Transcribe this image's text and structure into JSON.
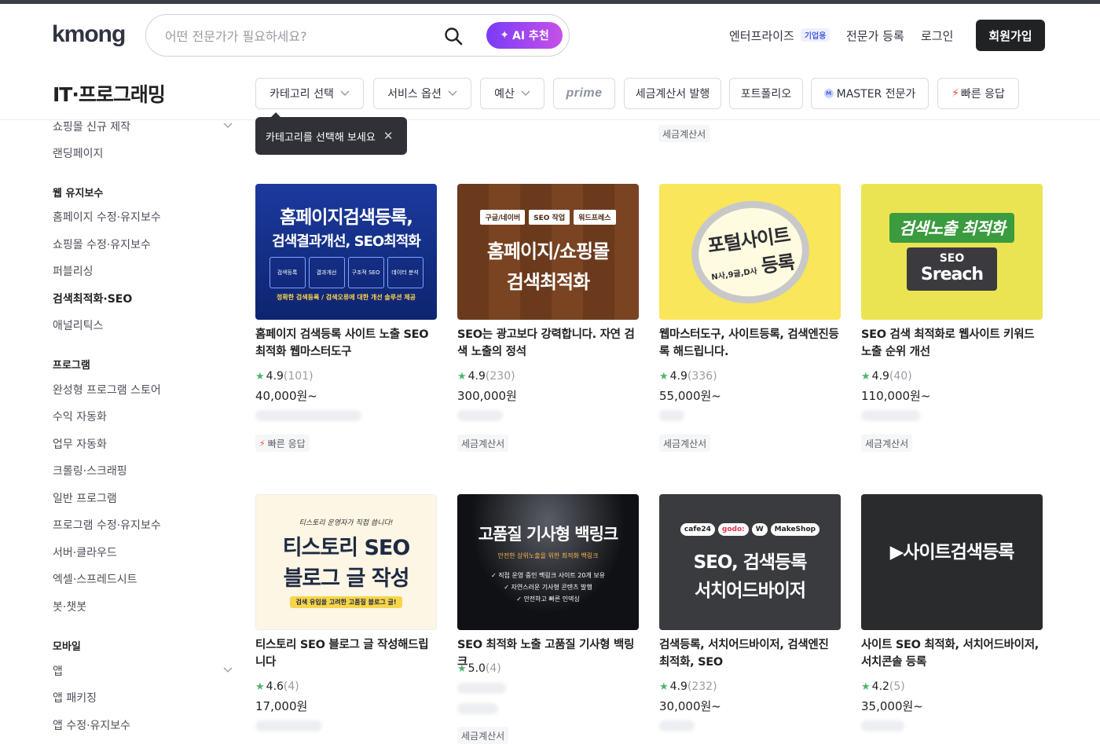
{
  "header": {
    "logo": "kmong",
    "search_placeholder": "어떤 전문가가 필요하세요?",
    "ai_label": "AI 추천",
    "nav": {
      "enterprise": "엔터프라이즈",
      "enterprise_badge": "기업용",
      "register_expert": "전문가 등록",
      "login": "로그인",
      "signup": "회원가입"
    }
  },
  "page_title": "IT·프로그래밍",
  "filters": {
    "category": "카테고리 선택",
    "service_option": "서비스 옵션",
    "budget": "예산",
    "prime": "prime",
    "tax_invoice": "세금계산서 발행",
    "portfolio": "포트폴리오",
    "master_badge": "M",
    "master": "MASTER 전문가",
    "fast_response": "빠른 응답"
  },
  "tooltip": {
    "text": "카테고리를 선택해 보세요"
  },
  "top_partial_tag": "세금계산서",
  "sidebar": {
    "items_top": [
      "쇼핑몰 신규 제작",
      "랜딩페이지"
    ],
    "web_maintenance_head": "웹 유지보수",
    "web_maintenance": [
      "홈페이지 수정·유지보수",
      "쇼핑몰 수정·유지보수",
      "퍼블리싱",
      "검색최적화·SEO",
      "애널리틱스"
    ],
    "program_head": "프로그램",
    "program": [
      "완성형 프로그램 스토어",
      "수익 자동화",
      "업무 자동화",
      "크롤링·스크래핑",
      "일반 프로그램",
      "프로그램 수정·유지보수",
      "서버·클라우드",
      "엑셀·스프레드시트",
      "봇·챗봇"
    ],
    "mobile_head": "모바일",
    "mobile": [
      "앱",
      "앱 패키징",
      "앱 수정·유지보수"
    ]
  },
  "cards": [
    {
      "thumb": {
        "title1": "홈페이지검색등록,",
        "title2": "검색결과개선, SEO최적화",
        "boxes": [
          "검색등록",
          "결과개선",
          "구조적 SEO",
          "데이터 분석"
        ],
        "footer": "정확한 검색등록 / 검색오류에 대한 개선 솔루션 제공"
      },
      "title": "홈페이지 검색등록 사이트 노출 SEO최적화 웹마스터도구",
      "rating": "4.9",
      "reviews": "(101)",
      "price": "40,000원~",
      "tag": "빠른 응답"
    },
    {
      "thumb": {
        "pills": [
          "구글/네이버",
          "SEO 작업",
          "워드프레스"
        ],
        "title1": "홈페이지/쇼핑몰",
        "title2": "검색최적화"
      },
      "title": "SEO는 광고보다 강력합니다. 자연 검색 노출의 정석",
      "rating": "4.9",
      "reviews": "(230)",
      "price": "300,000원",
      "tag": "세금계산서"
    },
    {
      "thumb": {
        "title1": "포털사이트",
        "title2": "등록",
        "sub": "N사,9글,D사"
      },
      "title": "웹마스터도구, 사이트등록, 검색엔진등록 해드립니다.",
      "rating": "4.9",
      "reviews": "(336)",
      "price": "55,000원~",
      "tag": "세금계산서"
    },
    {
      "thumb": {
        "title1": "검색노출 최적화",
        "title2": "SEO",
        "sub": "Sreach"
      },
      "title": "SEO 검색 최적화로 웹사이트 키워드 노출 순위 개선",
      "rating": "4.9",
      "reviews": "(40)",
      "price": "110,000원~",
      "tag": "세금계산서"
    },
    {
      "thumb": {
        "top": "티스토리 운영자가 직접 씁니다!",
        "title1": "티스토리 SEO",
        "title2": "블로그 글 작성",
        "sub": "검색 유입을 고려한 고품질 블로그 글!"
      },
      "title": "티스토리 SEO 블로그 글 작성해드립니다",
      "rating": "4.6",
      "reviews": "(4)",
      "price": "17,000원",
      "tag": ""
    },
    {
      "thumb": {
        "title1": "고품질 기사형 백링크",
        "sub": "안전한 상위노출을 위한 최적화 백링크",
        "line1": "✓ 직접 운영 중인 백링크 사이트 20개 보유",
        "line2": "✓ 자연스러운 기사형 콘텐츠 발행",
        "line3": "✓ 안전하고 빠른 인덱싱"
      },
      "title": "SEO 최적화 노출 고품질 기사형 백링크",
      "rating": "5.0",
      "reviews": "(4)",
      "price": "",
      "tag": "세금계산서"
    },
    {
      "thumb": {
        "logos": [
          "cafe24",
          "godo:",
          "W",
          "MakeShop"
        ],
        "title1": "SEO, 검색등록",
        "title2": "서치어드바이저"
      },
      "title": "검색등록, 서치어드바이저, 검색엔진 최적화, SEO",
      "rating": "4.9",
      "reviews": "(232)",
      "price": "30,000원~",
      "tag": ""
    },
    {
      "thumb": {
        "title1": "▶사이트검색등록"
      },
      "title": "사이트 SEO 최적화, 서치어드바이저, 서치콘솔 등록",
      "rating": "4.2",
      "reviews": "(5)",
      "price": "35,000원~",
      "tag": ""
    }
  ]
}
